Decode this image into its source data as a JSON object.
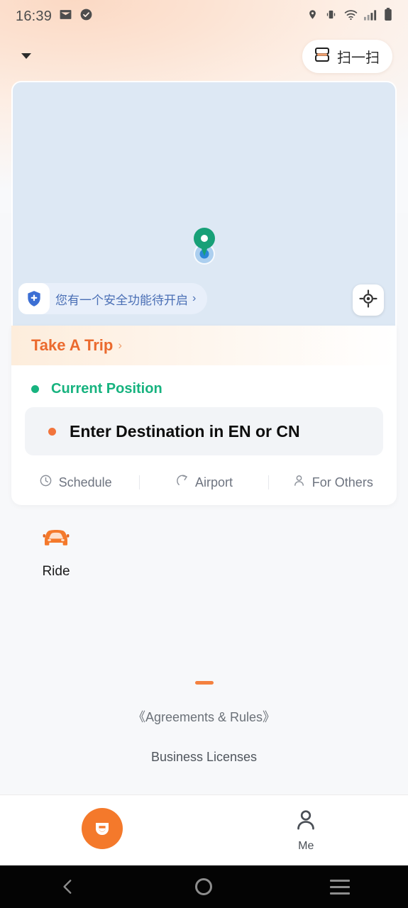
{
  "status_bar": {
    "time": "16:39",
    "left_icons": [
      "mail-icon",
      "check-circle-icon"
    ],
    "right_icons": [
      "location-pin-icon",
      "vibrate-icon",
      "wifi-icon",
      "signal-bars-icon",
      "battery-icon"
    ]
  },
  "header": {
    "dropdown_icon": "caret-down-icon",
    "scan_label": "扫一扫",
    "scan_icon": "scan-code-icon"
  },
  "map": {
    "pin_icon": "destination-pin-icon",
    "user_location_icon": "user-location-dot",
    "safety_banner": {
      "text": "您有一个安全功能待开启",
      "chevron": "›",
      "icon": "shield-plus-icon"
    },
    "locate_button_icon": "crosshair-locate-icon"
  },
  "booking": {
    "title": "Take A Trip",
    "title_chevron": "›",
    "current_position": "Current Position",
    "destination_placeholder": "Enter Destination in EN or CN",
    "quick_options": [
      {
        "label": "Schedule",
        "icon": "clock-icon"
      },
      {
        "label": "Airport",
        "icon": "airplane-icon"
      },
      {
        "label": "For Others",
        "icon": "person-icon"
      }
    ]
  },
  "services": [
    {
      "label": "Ride",
      "icon": "car-icon"
    }
  ],
  "footer": {
    "divider_icon": "orange-dash",
    "agreements": "《Agreements & Rules》",
    "licenses": "Business Licenses"
  },
  "bottom_nav": [
    {
      "label": "",
      "icon": "didi-logo-icon",
      "name": "home"
    },
    {
      "label": "Me",
      "icon": "person-icon",
      "name": "me"
    }
  ],
  "android_nav": {
    "back": "back-icon",
    "home": "home-icon",
    "recents": "recents-icon"
  },
  "colors": {
    "accent_orange": "#f4792b",
    "trip_orange": "#eb6a2e",
    "green": "#17b37f",
    "map_blue": "#dde8f4",
    "banner_blue": "#4a6fb5"
  }
}
